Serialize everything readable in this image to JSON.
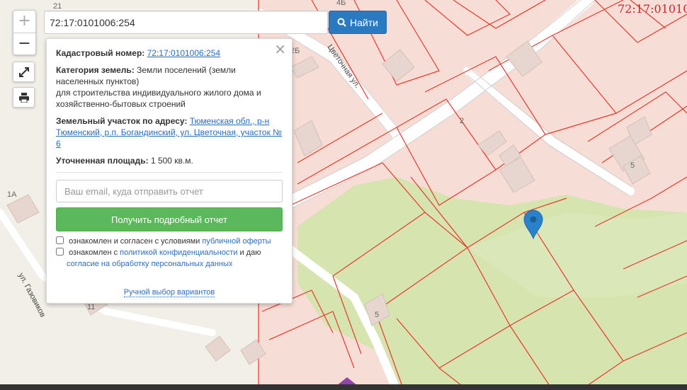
{
  "search": {
    "value": "72:17:0101006:254",
    "button_label": "Найти"
  },
  "zoom": {
    "in_label": "+",
    "out_label": "−"
  },
  "tools": {
    "fullscreen_icon": "expand-icon",
    "print_icon": "printer-icon"
  },
  "coordinate_label": "72:17:01010",
  "info_panel": {
    "close_label": "×",
    "cadastral_label": "Кадастровый номер:",
    "cadastral_value": "72:17:0101006:254",
    "category_label": "Категория земель:",
    "category_value_1": "Земли поселений (земли населенных пунктов)",
    "category_value_2": "для строительства индивидуального жилого дома и хозяйственно-бытовых строений",
    "address_label": "Земельный участок по адресу:",
    "address_value": "Тюменская обл., р-н Тюменский, р.п. Богандинский, ул. Цветочная, участок № 6",
    "area_label": "Уточненная площадь:",
    "area_value": "1 500 кв.м.",
    "email_placeholder": "Ваш email, куда отправить отчет",
    "report_button": "Получить подробный отчет",
    "consent1_text": "ознакомлен и согласен с условиями ",
    "consent1_link": "публичной оферты",
    "consent2_text": "ознакомлен с ",
    "consent2_link": "политикой конфиденциальности",
    "consent2_text2": " и даю ",
    "consent2_link2": "согласие на обработку персональных данных",
    "manual_link": "Ручной выбор вариантов"
  },
  "map_labels": {
    "street_1": "Цветочная ул.",
    "street_2": "ул. Газовиков",
    "house_21": "21",
    "house_4b": "4Б",
    "house_2b": "2Б",
    "house_2": "2",
    "house_5a": "5",
    "house_5b": "5",
    "house_1a": "1А",
    "house_11": "11"
  },
  "colors": {
    "parcel_fill": "#f6ddd5",
    "parcel_line": "#e8382d",
    "green": "#d6e4b0",
    "road": "#ffffff",
    "building": "#e6d6cf",
    "marker": "#2a81cb",
    "button_blue": "#2a7ac1",
    "button_green": "#5cb85c"
  }
}
